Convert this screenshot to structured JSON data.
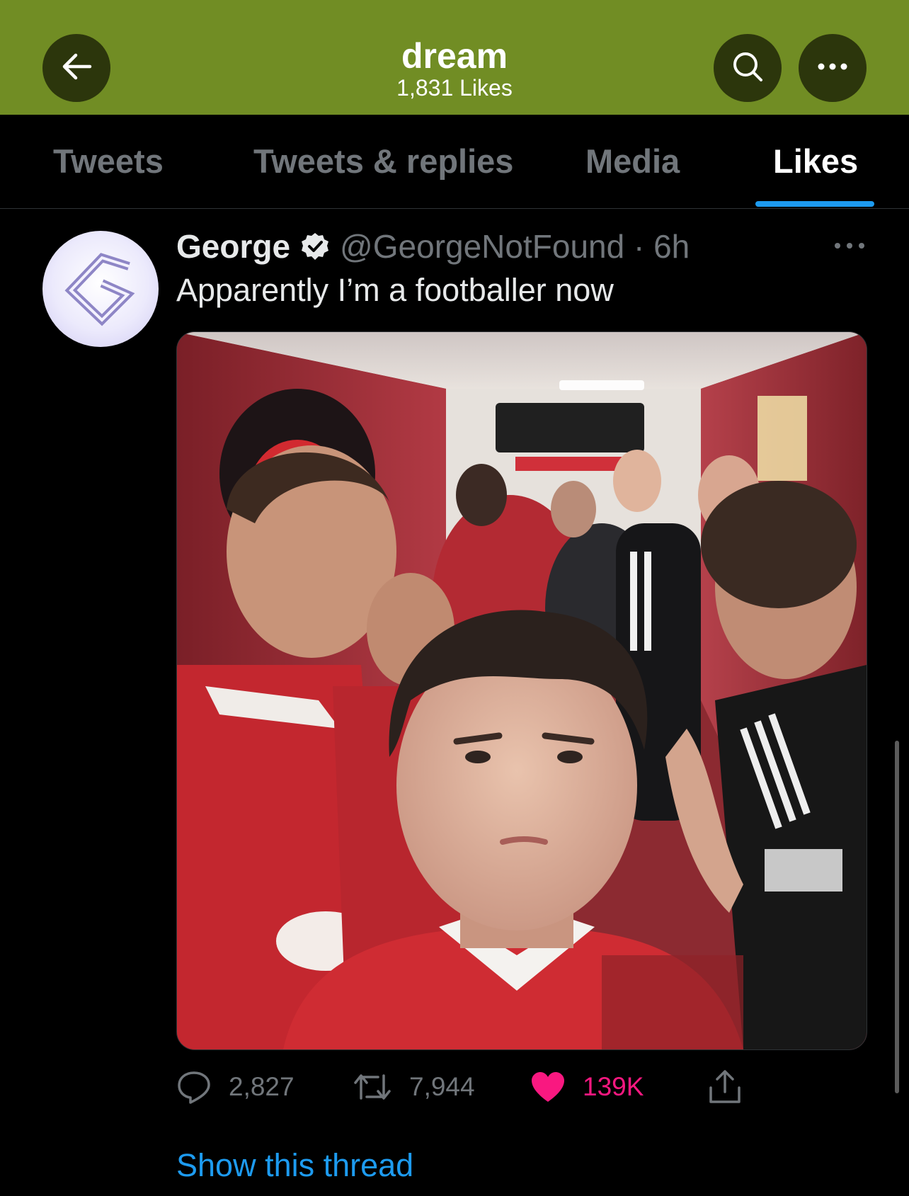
{
  "header": {
    "title": "dream",
    "subtitle": "1,831 Likes",
    "back_icon": "arrow-left-icon",
    "search_icon": "search-icon",
    "more_icon": "more-horizontal-icon",
    "background_color": "#718d24"
  },
  "tabs": [
    {
      "label": "Tweets",
      "active": false
    },
    {
      "label": "Tweets & replies",
      "active": false
    },
    {
      "label": "Media",
      "active": false
    },
    {
      "label": "Likes",
      "active": true
    }
  ],
  "tweet": {
    "name": "George",
    "verified": true,
    "handle_time": "@GeorgeNotFound · 6h",
    "text": "Apparently I’m a footballer now",
    "media_description": "selfie-in-stadium-tunnel",
    "actions": {
      "replies": "2,827",
      "retweets": "7,944",
      "likes": "139K",
      "liked": true
    }
  },
  "show_thread_label": "Show this thread",
  "colors": {
    "accent": "#1d9bf0",
    "like": "#f91880",
    "muted": "#71767b"
  }
}
